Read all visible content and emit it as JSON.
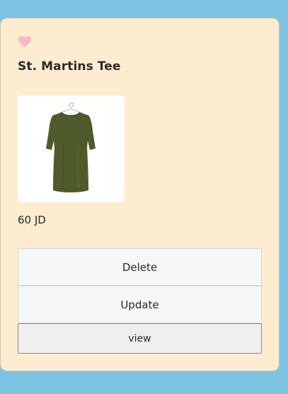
{
  "product": {
    "name": "St. Martins Tee",
    "price": "60 JD",
    "image_alt": "olive green t-shirt on hanger"
  },
  "actions": {
    "delete_label": "Delete",
    "update_label": "Update",
    "view_label": "view"
  },
  "colors": {
    "page_background": "#7cc3e3",
    "card_background": "#feecd0",
    "heart": "#f9b7c8",
    "shirt": "#4f5a2b"
  },
  "icons": {
    "favorite": "heart-icon"
  }
}
